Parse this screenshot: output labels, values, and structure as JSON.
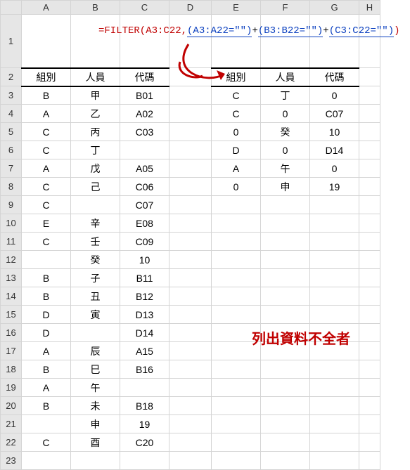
{
  "columns": [
    "A",
    "B",
    "C",
    "D",
    "E",
    "F",
    "G",
    "H"
  ],
  "rows": [
    "1",
    "2",
    "3",
    "4",
    "5",
    "6",
    "7",
    "8",
    "9",
    "10",
    "11",
    "12",
    "13",
    "14",
    "15",
    "16",
    "17",
    "18",
    "19",
    "20",
    "21",
    "22",
    "23"
  ],
  "headers_left": {
    "A": "組別",
    "B": "人員",
    "C": "代碼"
  },
  "headers_right": {
    "E": "組別",
    "F": "人員",
    "G": "代碼"
  },
  "left_data": [
    {
      "A": "B",
      "B": "甲",
      "C": "B01"
    },
    {
      "A": "A",
      "B": "乙",
      "C": "A02"
    },
    {
      "A": "C",
      "B": "丙",
      "C": "C03"
    },
    {
      "A": "C",
      "B": "丁",
      "C": ""
    },
    {
      "A": "A",
      "B": "戊",
      "C": "A05"
    },
    {
      "A": "C",
      "B": "己",
      "C": "C06"
    },
    {
      "A": "C",
      "B": "",
      "C": "C07"
    },
    {
      "A": "E",
      "B": "辛",
      "C": "E08"
    },
    {
      "A": "C",
      "B": "壬",
      "C": "C09"
    },
    {
      "A": "",
      "B": "癸",
      "C": "10"
    },
    {
      "A": "B",
      "B": "子",
      "C": "B11"
    },
    {
      "A": "B",
      "B": "丑",
      "C": "B12"
    },
    {
      "A": "D",
      "B": "寅",
      "C": "D13"
    },
    {
      "A": "D",
      "B": "",
      "C": "D14"
    },
    {
      "A": "A",
      "B": "辰",
      "C": "A15"
    },
    {
      "A": "B",
      "B": "巳",
      "C": "B16"
    },
    {
      "A": "A",
      "B": "午",
      "C": ""
    },
    {
      "A": "B",
      "B": "未",
      "C": "B18"
    },
    {
      "A": "",
      "B": "申",
      "C": "19"
    },
    {
      "A": "C",
      "B": "酉",
      "C": "C20"
    }
  ],
  "right_data": [
    {
      "E": "C",
      "F": "丁",
      "G": "0"
    },
    {
      "E": "C",
      "F": "0",
      "G": "C07"
    },
    {
      "E": "0",
      "F": "癸",
      "G": "10"
    },
    {
      "E": "D",
      "F": "0",
      "G": "D14"
    },
    {
      "E": "A",
      "F": "午",
      "G": "0"
    },
    {
      "E": "0",
      "F": "申",
      "G": "19"
    }
  ],
  "formula": {
    "eq": "=FILTER(A3:C22,",
    "p1": "(A3:A22=\"\")",
    "plus1": "+",
    "p2": "(B3:B22=\"\")",
    "plus2": "+",
    "p3": "(C3:C22=\"\")",
    "close": ")"
  },
  "red_label": "列出資料不全者"
}
